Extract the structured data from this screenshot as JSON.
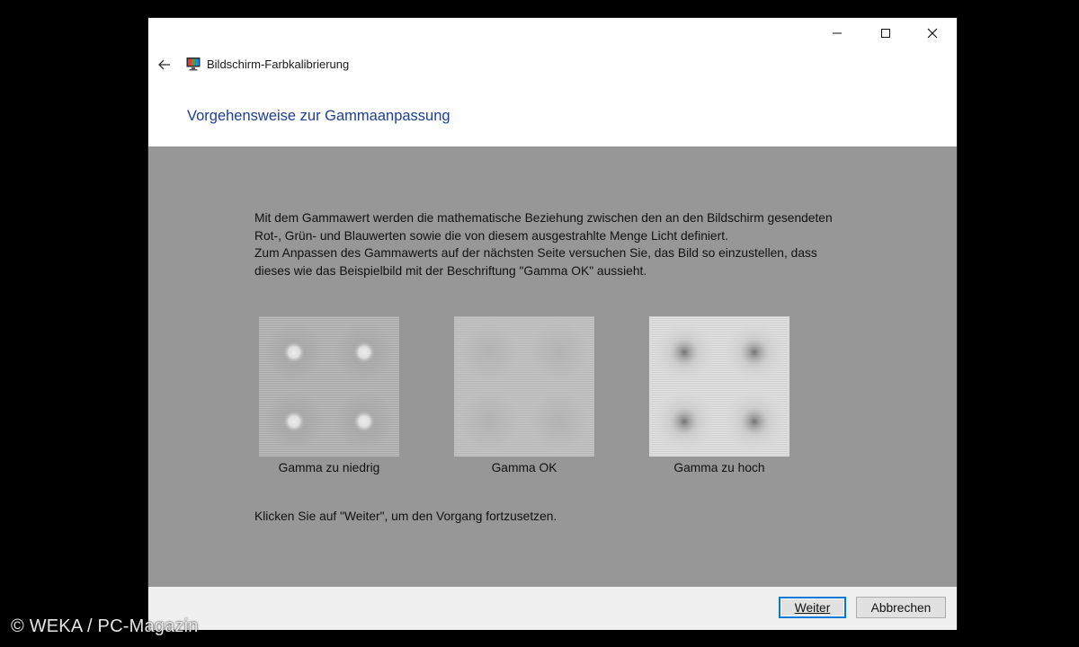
{
  "window": {
    "title": "Bildschirm-Farbkalibrierung",
    "controls": {
      "minimize": "minimize-icon",
      "maximize": "maximize-icon",
      "close": "close-icon"
    },
    "back_icon": "back-arrow-icon",
    "app_icon": "display-calibration-icon"
  },
  "page": {
    "heading": "Vorgehensweise zur Gammaanpassung",
    "description_1": "Mit dem Gammawert werden die mathematische Beziehung zwischen den an den Bildschirm gesendeten Rot-, Grün- und Blauwerten sowie die von diesem ausgestrahlte Menge Licht definiert.",
    "description_2": "Zum Anpassen des Gammawerts auf der nächsten Seite versuchen Sie, das Bild so einzustellen, dass dieses wie das Beispielbild mit der Beschriftung \"Gamma OK\" aussieht.",
    "samples": [
      {
        "label": "Gamma zu niedrig"
      },
      {
        "label": "Gamma OK"
      },
      {
        "label": "Gamma zu hoch"
      }
    ],
    "hint": "Klicken Sie auf \"Weiter\", um den Vorgang fortzusetzen."
  },
  "footer": {
    "next_label": "Weiter",
    "cancel_label": "Abbrechen"
  },
  "watermark": "© WEKA / PC-Magazin",
  "colors": {
    "heading": "#1c3f94",
    "content_bg": "#979797",
    "focus_border": "#0078d7"
  }
}
